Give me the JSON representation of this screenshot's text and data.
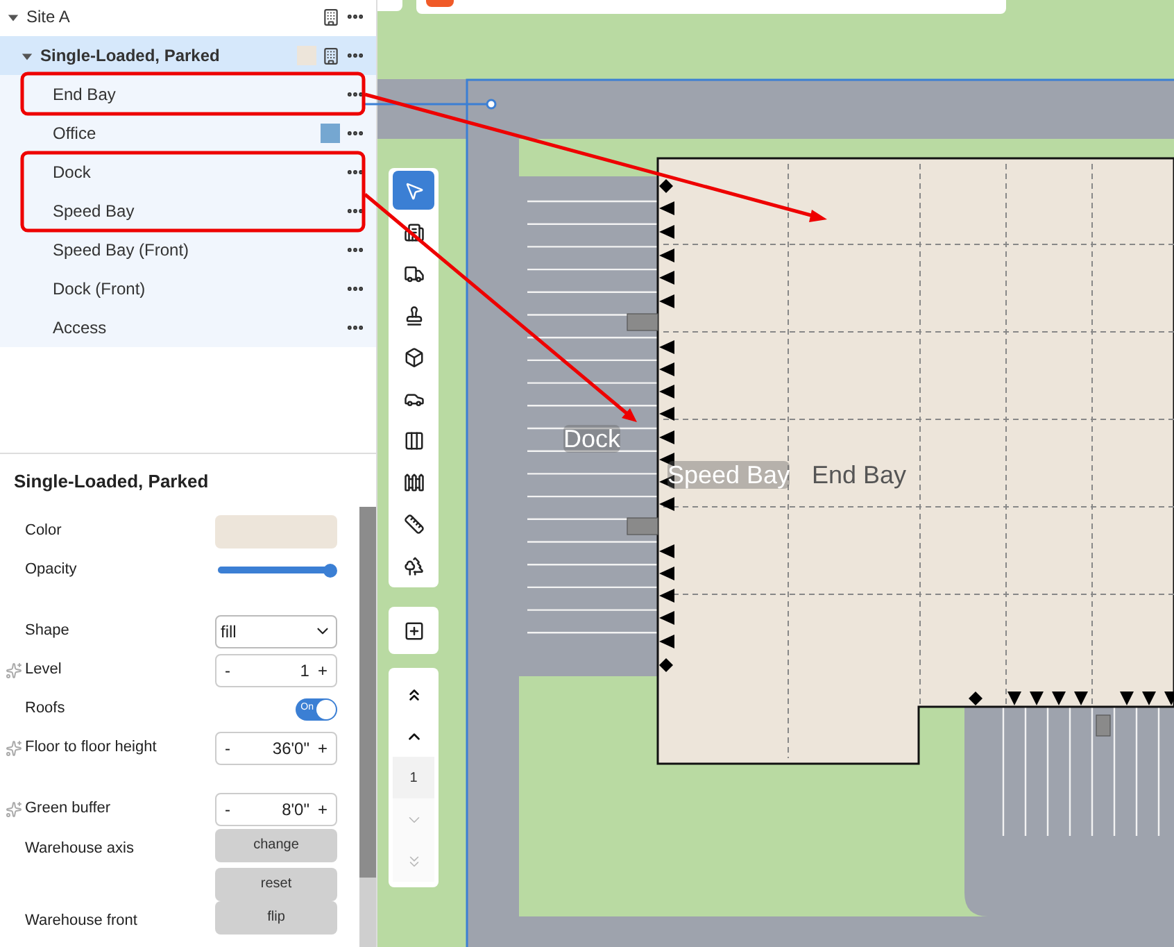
{
  "tree": [
    {
      "name": "Site A",
      "expanded": true,
      "selected": false,
      "building": true,
      "children": [
        {
          "name": "Single-Loaded, Parked",
          "expanded": true,
          "selected": true,
          "building": true,
          "color": "#ede5da",
          "children": [
            {
              "name": "End Bay",
              "selected": false
            },
            {
              "name": "Office",
              "selected": false,
              "color": "#75a7d1"
            },
            {
              "name": "Dock",
              "selected": false
            },
            {
              "name": "Speed Bay",
              "selected": false
            },
            {
              "name": "Speed Bay (Front)",
              "selected": false
            },
            {
              "name": "Dock (Front)",
              "selected": false
            },
            {
              "name": "Access",
              "selected": false
            }
          ]
        }
      ]
    }
  ],
  "properties": {
    "title": "Single-Loaded, Parked",
    "sections": [
      [
        {
          "kind": "color",
          "label": "Color",
          "color": "#ede5da",
          "sparkle": false
        },
        {
          "kind": "slider",
          "label": "Opacity",
          "level": 1,
          "sparkle": false
        }
      ],
      [
        {
          "kind": "select",
          "label": "Shape",
          "value": "fill",
          "sparkle": false
        },
        {
          "kind": "stepper",
          "label": "Level",
          "minus": "-",
          "value": "1",
          "plus": "+",
          "sparkle": true
        },
        {
          "kind": "toggle",
          "label": "Roofs",
          "on": true,
          "text": "On",
          "sparkle": false
        },
        {
          "kind": "stepper",
          "label": "Floor to floor height",
          "minus": "-",
          "value": "36'0\"",
          "plus": "+",
          "sparkle": true
        }
      ],
      [
        {
          "kind": "stepper",
          "label": "Green buffer",
          "minus": "-",
          "value": "8'0\"",
          "plus": "+",
          "sparkle": true
        },
        {
          "kind": "buttons",
          "label": "Warehouse axis",
          "buttons": [
            "change",
            "reset"
          ],
          "sparkle": false
        },
        {
          "kind": "buttons",
          "label": "Warehouse front",
          "buttons": [
            "flip"
          ],
          "sparkle": false
        }
      ]
    ]
  },
  "tools": [
    {
      "kind": "pointer",
      "selected": true
    },
    {
      "kind": "building",
      "selected": false
    },
    {
      "kind": "truck",
      "selected": false
    },
    {
      "kind": "stamp",
      "selected": false
    },
    {
      "kind": "cube",
      "selected": false
    },
    {
      "kind": "car",
      "selected": false
    },
    {
      "kind": "columns",
      "selected": false
    },
    {
      "kind": "barrier",
      "selected": false
    },
    {
      "kind": "ruler",
      "selected": false
    },
    {
      "kind": "trees",
      "selected": false
    }
  ],
  "level_nav": {
    "items": [
      {
        "kind": "top",
        "disabled": false
      },
      {
        "kind": "up",
        "disabled": false
      },
      {
        "kind": "current",
        "text": "1"
      },
      {
        "kind": "down",
        "disabled": true
      },
      {
        "kind": "bottom",
        "disabled": true
      }
    ]
  },
  "map_labels": [
    {
      "text": "Dock",
      "color": "#ffffff"
    },
    {
      "text": "Speed Bay",
      "color": "#ffffff"
    },
    {
      "text": "End Bay",
      "color": "#555555"
    }
  ]
}
